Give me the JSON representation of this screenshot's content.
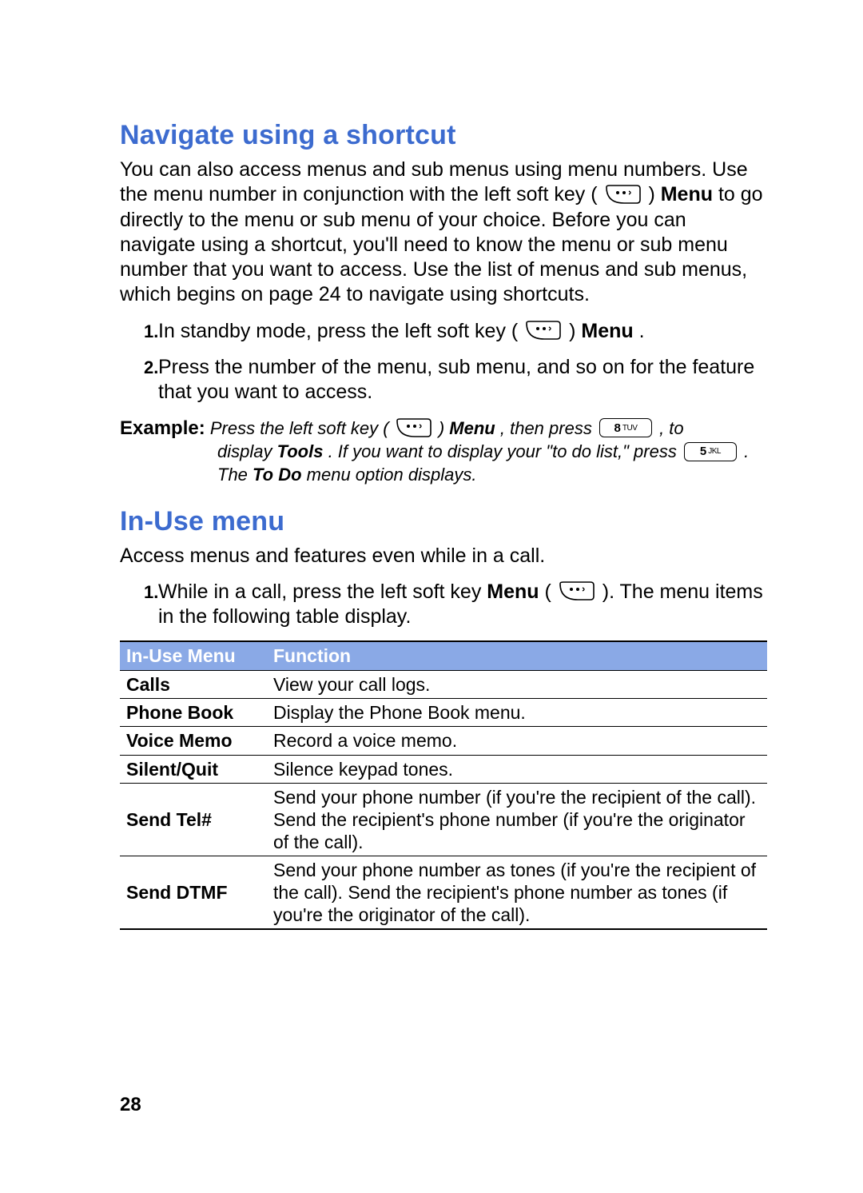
{
  "section1": {
    "heading": "Navigate using a shortcut",
    "intro_pre": "You can also access menus and sub menus using menu numbers. Use the menu number in conjunction with the left soft key (",
    "intro_mid": ") ",
    "intro_menu": "Menu",
    "intro_post": " to go directly to the menu or sub menu of your choice. Before you can navigate using a shortcut, you'll need to know the menu or sub menu number that you want to access. Use the list of menus and sub menus, which begins on page 24 to navigate using shortcuts.",
    "steps": [
      {
        "marker": "1.",
        "pre": "In standby mode, press the left soft key (",
        "mid": ") ",
        "menu": "Menu",
        "post": "."
      },
      {
        "marker": "2.",
        "text": "Press the number of the menu, sub menu, and so on for the feature that you want to access."
      }
    ],
    "example": {
      "label": "Example:",
      "line1_pre": " Press the left soft key (",
      "line1_mid": ") ",
      "line1_menu": "Menu",
      "line1_mid2": ", then press ",
      "key8_n": "8",
      "key8_l": "TUV",
      "line1_post": ", to ",
      "line2_pre": "display ",
      "tools": "Tools",
      "line2_mid": ". If you want to display your \"to do list,\" press ",
      "key5_n": "5",
      "key5_l": "JKL",
      "line2_mid2": ". The ",
      "todo": "To Do",
      "line2_post": " menu option displays."
    }
  },
  "section2": {
    "heading": "In-Use menu",
    "intro": "Access menus and features even while in a call.",
    "step": {
      "marker": "1.",
      "pre": "While in a call, press the left soft key ",
      "menu": "Menu",
      "mid": " (",
      "post": "). The menu items in the following table display."
    },
    "table": {
      "headers": [
        "In-Use Menu",
        "Function"
      ],
      "rows": [
        {
          "name": "Calls",
          "func": "View your call logs."
        },
        {
          "name": "Phone Book",
          "func": "Display the Phone Book menu."
        },
        {
          "name": "Voice Memo",
          "func": "Record a voice memo."
        },
        {
          "name": "Silent/Quit",
          "func": "Silence keypad tones."
        },
        {
          "name": "Send Tel#",
          "func": "Send your phone number (if you're the recipient of the call). Send the recipient's phone number (if you're the originator of the call)."
        },
        {
          "name": "Send DTMF",
          "func": "Send your phone number as tones (if you're the recipient of the call). Send the recipient's phone number as tones (if you're the originator of the call)."
        }
      ]
    }
  },
  "page_number": "28"
}
